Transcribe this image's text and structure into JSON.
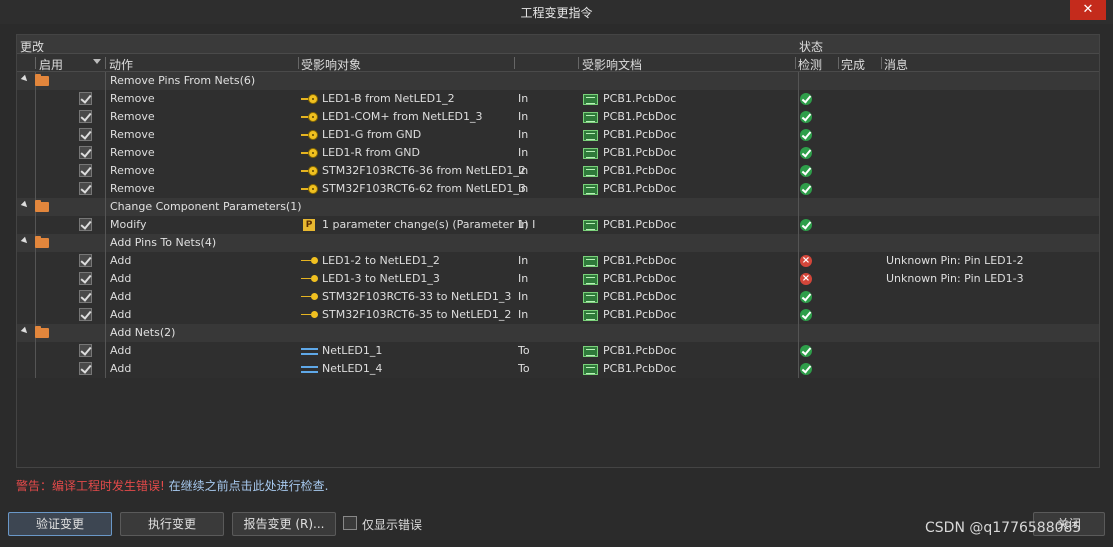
{
  "window": {
    "title": "工程变更指令",
    "close_label": "✕"
  },
  "groups": {
    "changes": "更改",
    "status": "状态"
  },
  "columns": {
    "enable": "启用",
    "action": "动作",
    "object": "受影响对象",
    "document": "受影响文档",
    "check": "检测",
    "done": "完成",
    "message": "消息"
  },
  "rows": [
    {
      "type": "group",
      "label": "Remove Pins From Nets(6)"
    },
    {
      "type": "item",
      "action": "Remove",
      "object": "LED1-B from NetLED1_2",
      "icon": "pin-remove-icon",
      "dir": "In",
      "doc": "PCB1.PcbDoc",
      "status": "ok",
      "msg": ""
    },
    {
      "type": "item",
      "action": "Remove",
      "object": "LED1-COM+ from NetLED1_3",
      "icon": "pin-remove-icon",
      "dir": "In",
      "doc": "PCB1.PcbDoc",
      "status": "ok",
      "msg": ""
    },
    {
      "type": "item",
      "action": "Remove",
      "object": "LED1-G from GND",
      "icon": "pin-remove-icon",
      "dir": "In",
      "doc": "PCB1.PcbDoc",
      "status": "ok",
      "msg": ""
    },
    {
      "type": "item",
      "action": "Remove",
      "object": "LED1-R from GND",
      "icon": "pin-remove-icon",
      "dir": "In",
      "doc": "PCB1.PcbDoc",
      "status": "ok",
      "msg": ""
    },
    {
      "type": "item",
      "action": "Remove",
      "object": "STM32F103RCT6-36 from NetLED1_2",
      "icon": "pin-remove-icon",
      "dir": "In",
      "doc": "PCB1.PcbDoc",
      "status": "ok",
      "msg": ""
    },
    {
      "type": "item",
      "action": "Remove",
      "object": "STM32F103RCT6-62 from NetLED1_3",
      "icon": "pin-remove-icon",
      "dir": "In",
      "doc": "PCB1.PcbDoc",
      "status": "ok",
      "msg": ""
    },
    {
      "type": "group",
      "label": "Change Component Parameters(1)"
    },
    {
      "type": "item",
      "action": "Modify",
      "object": "1 parameter change(s) (Parameter 1) Ir",
      "icon": "parameter-icon",
      "dir": "In",
      "doc": "PCB1.PcbDoc",
      "status": "ok",
      "msg": ""
    },
    {
      "type": "group",
      "label": "Add Pins To Nets(4)"
    },
    {
      "type": "item",
      "action": "Add",
      "object": "LED1-2 to NetLED1_2",
      "icon": "pin-add-icon",
      "dir": "In",
      "doc": "PCB1.PcbDoc",
      "status": "error",
      "msg": "Unknown Pin: Pin LED1-2"
    },
    {
      "type": "item",
      "action": "Add",
      "object": "LED1-3 to NetLED1_3",
      "icon": "pin-add-icon",
      "dir": "In",
      "doc": "PCB1.PcbDoc",
      "status": "error",
      "msg": "Unknown Pin: Pin LED1-3"
    },
    {
      "type": "item",
      "action": "Add",
      "object": "STM32F103RCT6-33 to NetLED1_3",
      "icon": "pin-add-icon",
      "dir": "In",
      "doc": "PCB1.PcbDoc",
      "status": "ok",
      "msg": ""
    },
    {
      "type": "item",
      "action": "Add",
      "object": "STM32F103RCT6-35 to NetLED1_2",
      "icon": "pin-add-icon",
      "dir": "In",
      "doc": "PCB1.PcbDoc",
      "status": "ok",
      "msg": ""
    },
    {
      "type": "group",
      "label": "Add Nets(2)"
    },
    {
      "type": "item",
      "action": "Add",
      "object": "NetLED1_1",
      "icon": "net-icon",
      "dir": "To",
      "doc": "PCB1.PcbDoc",
      "status": "ok",
      "msg": ""
    },
    {
      "type": "item",
      "action": "Add",
      "object": "NetLED1_4",
      "icon": "net-icon",
      "dir": "To",
      "doc": "PCB1.PcbDoc",
      "status": "ok",
      "msg": ""
    }
  ],
  "warning": {
    "prefix": "警告：编译工程时发生错误!",
    "link": "在继续之前点击此处进行检查."
  },
  "buttons": {
    "validate": "验证变更",
    "execute": "执行变更",
    "report": "报告变更 (R)...",
    "only_errors": "仅显示错误",
    "close": "关闭"
  },
  "watermark": "CSDN @q1776588085"
}
